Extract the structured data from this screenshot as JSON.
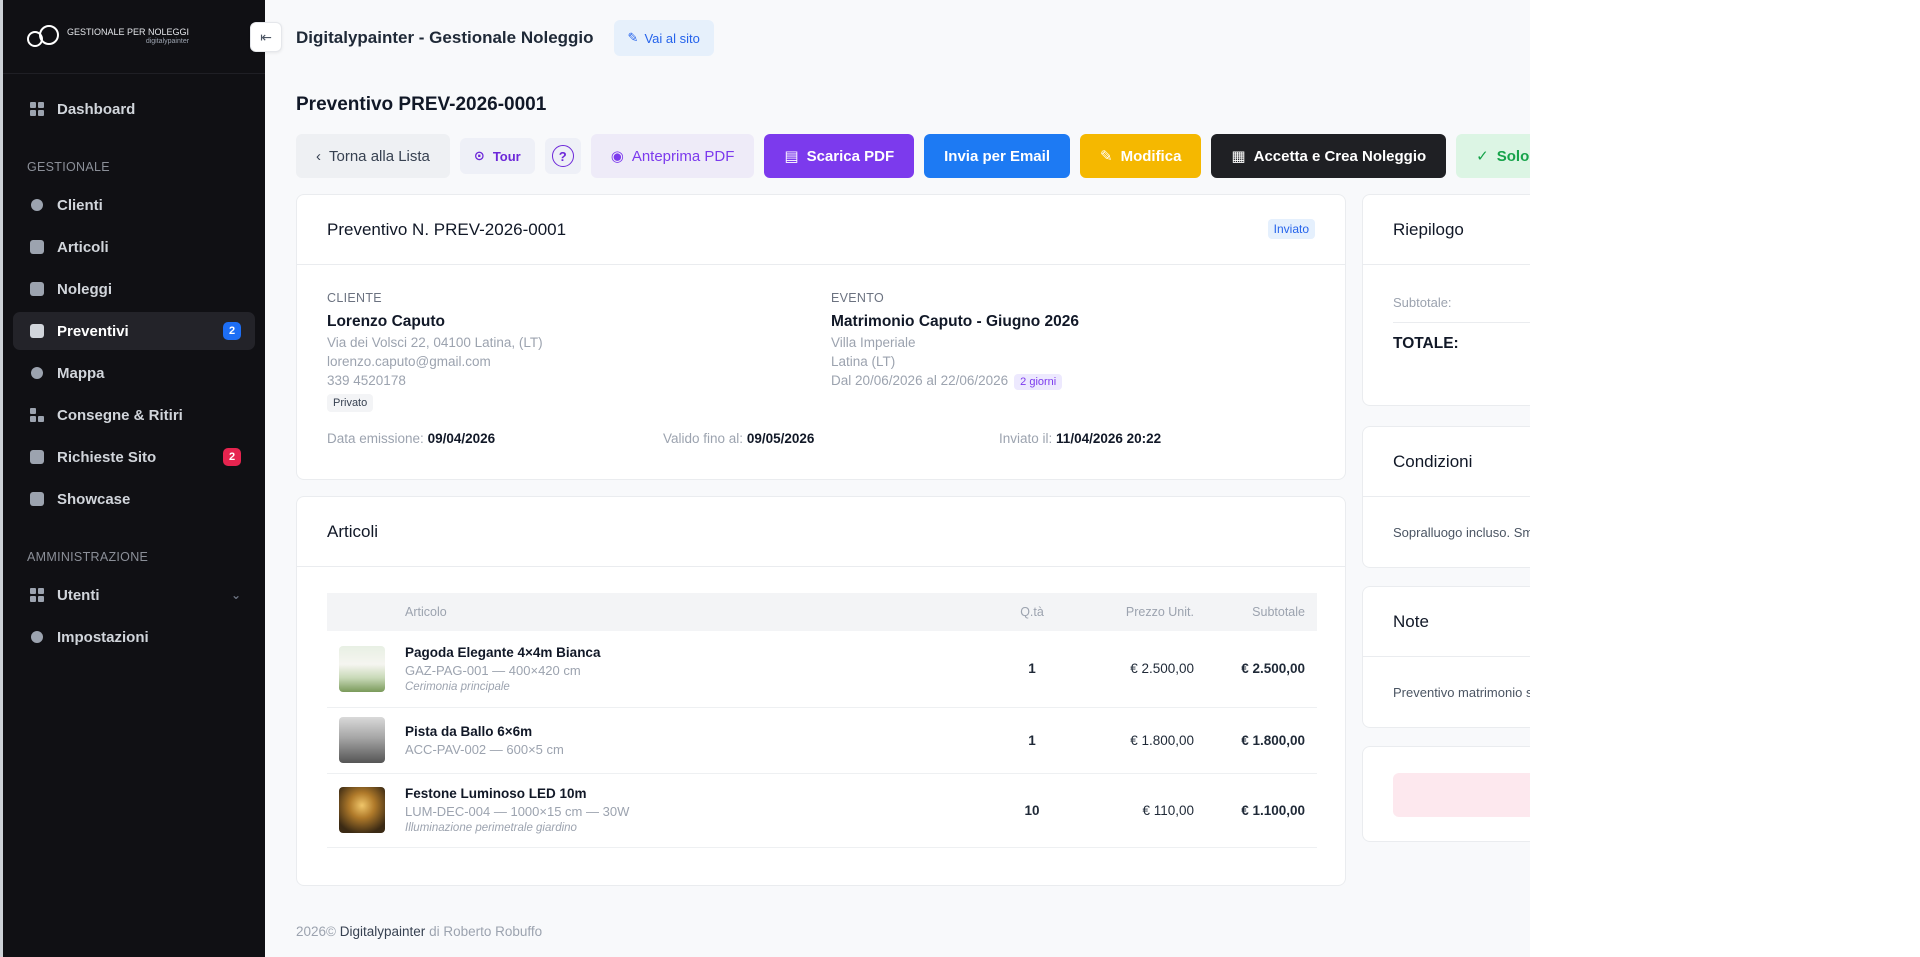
{
  "brand": {
    "line1": "GESTIONALE PER NOLEGGI",
    "line2": "digitalypainter"
  },
  "sidebar": {
    "items_top": [
      {
        "label": "Dashboard"
      }
    ],
    "section_gestionale": "GESTIONALE",
    "items_gestionale": [
      {
        "label": "Clienti"
      },
      {
        "label": "Articoli"
      },
      {
        "label": "Noleggi"
      },
      {
        "label": "Preventivi",
        "badge": "2"
      },
      {
        "label": "Mappa"
      },
      {
        "label": "Consegne & Ritiri"
      },
      {
        "label": "Richieste Sito",
        "badge": "2"
      },
      {
        "label": "Showcase"
      }
    ],
    "section_admin": "AMMINISTRAZIONE",
    "items_admin": [
      {
        "label": "Utenti"
      },
      {
        "label": "Impostazioni"
      }
    ]
  },
  "header": {
    "title": "Digitalypainter - Gestionale Noleggio",
    "site_button": "Vai al sito"
  },
  "page": {
    "title": "Preventivo PREV-2026-0001"
  },
  "actions": {
    "back": "Torna alla Lista",
    "tour": "Tour",
    "help": "?",
    "preview_pdf": "Anteprima PDF",
    "download_pdf": "Scarica PDF",
    "send_email": "Invia per Email",
    "edit": "Modifica",
    "accept": "Accetta e Crea Noleggio",
    "only": "Solo S"
  },
  "quote": {
    "title": "Preventivo N. PREV-2026-0001",
    "status": "Inviato",
    "client_label": "CLIENTE",
    "client_name": "Lorenzo Caputo",
    "client_address": "Via dei Volsci 22, 04100 Latina, (LT)",
    "client_email": "lorenzo.caputo@gmail.com",
    "client_phone": "339 4520178",
    "client_type": "Privato",
    "event_label": "EVENTO",
    "event_name": "Matrimonio Caputo - Giugno 2026",
    "event_place": "Villa Imperiale",
    "event_city": "Latina (LT)",
    "event_dates": "Dal 20/06/2026 al 22/06/2026",
    "event_days": "2 giorni",
    "issue_label": "Data emissione:",
    "issue_date": "09/04/2026",
    "valid_label": "Valido fino al:",
    "valid_date": "09/05/2026",
    "sent_label": "Inviato il:",
    "sent_date": "11/04/2026 20:22"
  },
  "articles": {
    "title": "Articoli",
    "columns": {
      "article": "Articolo",
      "qty": "Q.tà",
      "unit": "Prezzo Unit.",
      "subtotal": "Subtotale"
    },
    "rows": [
      {
        "name": "Pagoda Elegante 4×4m Bianca",
        "sku": "GAZ-PAG-001 — 400×420 cm",
        "note": "Cerimonia principale",
        "qty": "1",
        "unit": "€ 2.500,00",
        "subtotal": "€ 2.500,00"
      },
      {
        "name": "Pista da Ballo 6×6m",
        "sku": "ACC-PAV-002 — 600×5 cm",
        "note": "",
        "qty": "1",
        "unit": "€ 1.800,00",
        "subtotal": "€ 1.800,00"
      },
      {
        "name": "Festone Luminoso LED 10m",
        "sku": "LUM-DEC-004 — 1000×15 cm — 30W",
        "note": "Illuminazione perimetrale giardino",
        "qty": "10",
        "unit": "€ 110,00",
        "subtotal": "€ 1.100,00"
      }
    ]
  },
  "summary": {
    "title": "Riepilogo",
    "subtotal_label": "Subtotale:",
    "total_label": "TOTALE:"
  },
  "conditions": {
    "title": "Condizioni",
    "text": "Sopralluogo incluso. Sm"
  },
  "notes": {
    "title": "Note",
    "text": "Preventivo matrimonio s"
  },
  "footer": {
    "year": "2026©",
    "brand": "Digitalypainter",
    "by": "di Roberto Robuffo"
  }
}
